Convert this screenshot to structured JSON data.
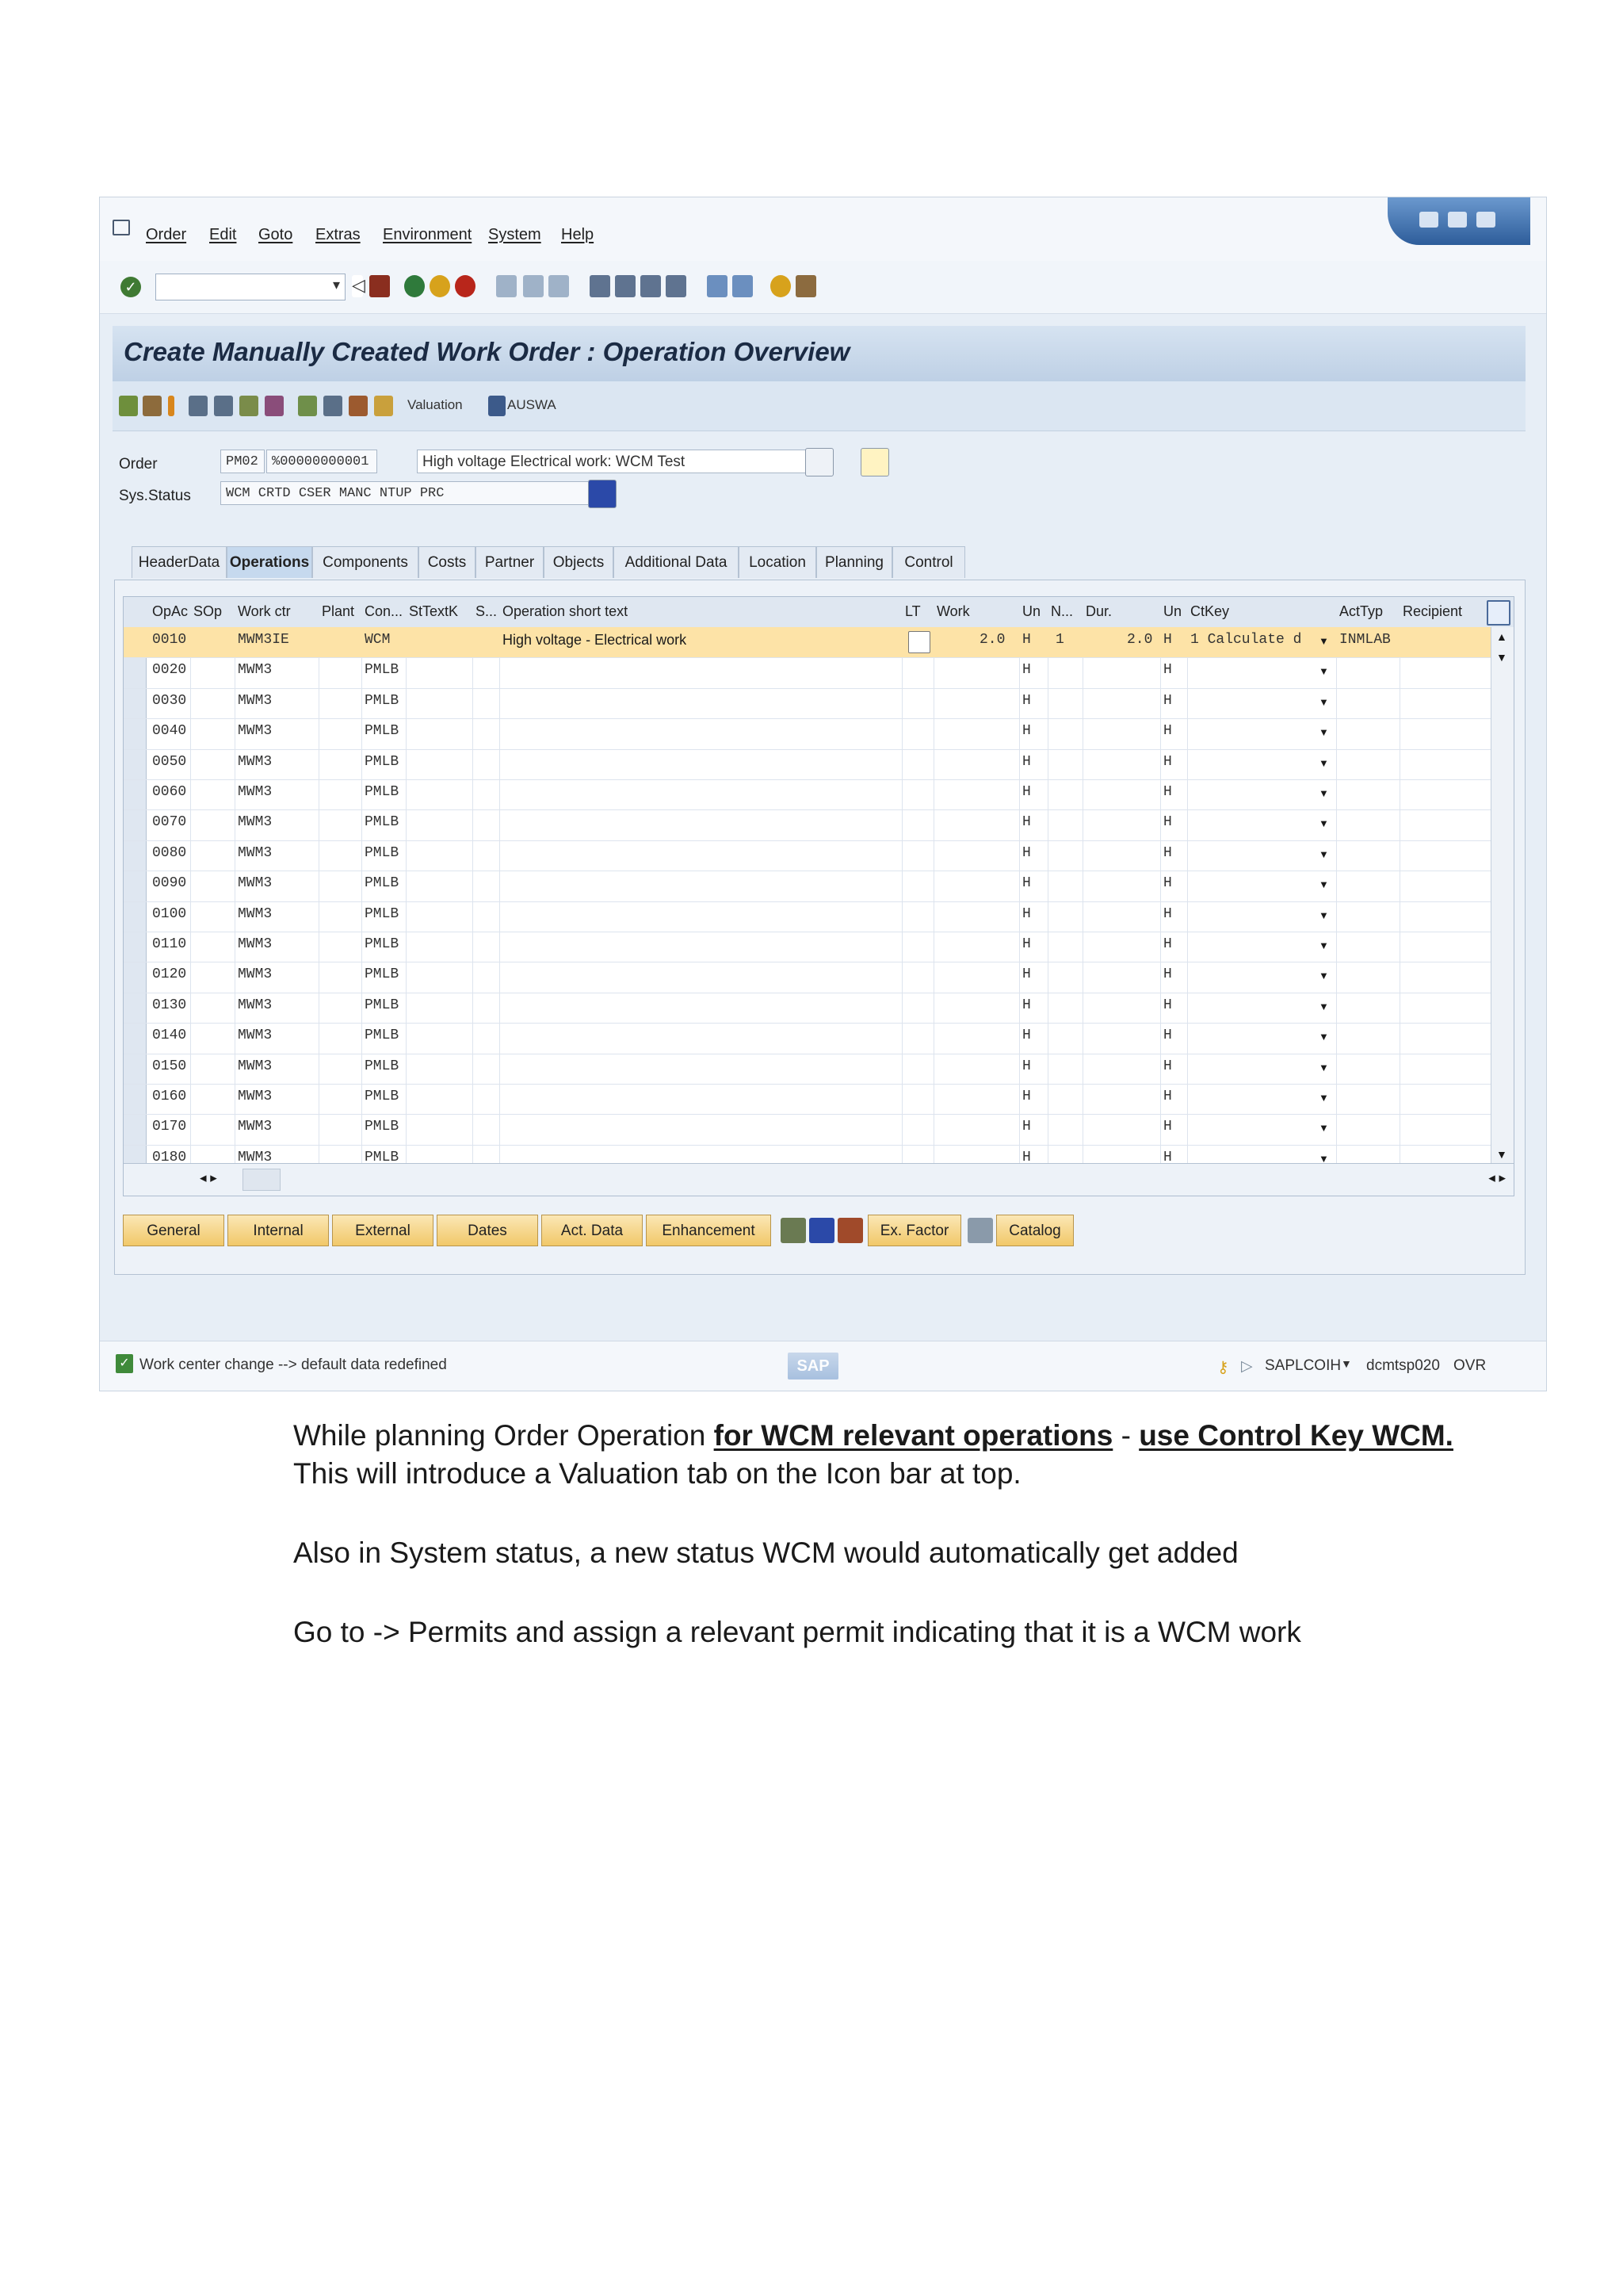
{
  "menu": [
    "Order",
    "Edit",
    "Goto",
    "Extras",
    "Environment",
    "System",
    "Help"
  ],
  "title": "Create Manually Created Work Order : Operation Overview",
  "app_toolbar": {
    "valuation_label": "Valuation",
    "auswa_label": "AUSWA"
  },
  "header": {
    "order_label": "Order",
    "order_type": "PM02",
    "order_number": "%00000000001",
    "order_description": "High voltage Electrical work: WCM Test",
    "sys_status_label": "Sys.Status",
    "sys_status_value": "WCM  CRTD CSER MANC NTUP PRC"
  },
  "tabs": [
    "HeaderData",
    "Operations",
    "Components",
    "Costs",
    "Partner",
    "Objects",
    "Additional Data",
    "Location",
    "Planning",
    "Control"
  ],
  "active_tab": "Operations",
  "grid": {
    "columns": [
      "OpAc",
      "SOp",
      "Work ctr",
      "Plant",
      "Con...",
      "StTextK",
      "S...",
      "Operation short text",
      "LT",
      "Work",
      "Un",
      "N...",
      "Dur.",
      "Un",
      "CtKey",
      "ActTyp",
      "Recipient"
    ],
    "rows": [
      {
        "opac": "0010",
        "workctr": "MWM3IE",
        "con": "WCM",
        "text": "High voltage - Electrical work",
        "work": "2.0",
        "un": "H",
        "n": "1",
        "dur": "2.0",
        "un2": "H",
        "ctkey": "1 Calculate d",
        "acttyp": "INMLAB",
        "selected": true
      },
      {
        "opac": "0020",
        "workctr": "MWM3",
        "con": "PMLB",
        "text": "",
        "work": "",
        "un": "H",
        "n": "",
        "dur": "",
        "un2": "H",
        "ctkey": "",
        "acttyp": ""
      },
      {
        "opac": "0030",
        "workctr": "MWM3",
        "con": "PMLB",
        "text": "",
        "work": "",
        "un": "H",
        "n": "",
        "dur": "",
        "un2": "H",
        "ctkey": "",
        "acttyp": ""
      },
      {
        "opac": "0040",
        "workctr": "MWM3",
        "con": "PMLB",
        "text": "",
        "work": "",
        "un": "H",
        "n": "",
        "dur": "",
        "un2": "H",
        "ctkey": "",
        "acttyp": ""
      },
      {
        "opac": "0050",
        "workctr": "MWM3",
        "con": "PMLB",
        "text": "",
        "work": "",
        "un": "H",
        "n": "",
        "dur": "",
        "un2": "H",
        "ctkey": "",
        "acttyp": ""
      },
      {
        "opac": "0060",
        "workctr": "MWM3",
        "con": "PMLB",
        "text": "",
        "work": "",
        "un": "H",
        "n": "",
        "dur": "",
        "un2": "H",
        "ctkey": "",
        "acttyp": ""
      },
      {
        "opac": "0070",
        "workctr": "MWM3",
        "con": "PMLB",
        "text": "",
        "work": "",
        "un": "H",
        "n": "",
        "dur": "",
        "un2": "H",
        "ctkey": "",
        "acttyp": ""
      },
      {
        "opac": "0080",
        "workctr": "MWM3",
        "con": "PMLB",
        "text": "",
        "work": "",
        "un": "H",
        "n": "",
        "dur": "",
        "un2": "H",
        "ctkey": "",
        "acttyp": ""
      },
      {
        "opac": "0090",
        "workctr": "MWM3",
        "con": "PMLB",
        "text": "",
        "work": "",
        "un": "H",
        "n": "",
        "dur": "",
        "un2": "H",
        "ctkey": "",
        "acttyp": ""
      },
      {
        "opac": "0100",
        "workctr": "MWM3",
        "con": "PMLB",
        "text": "",
        "work": "",
        "un": "H",
        "n": "",
        "dur": "",
        "un2": "H",
        "ctkey": "",
        "acttyp": ""
      },
      {
        "opac": "0110",
        "workctr": "MWM3",
        "con": "PMLB",
        "text": "",
        "work": "",
        "un": "H",
        "n": "",
        "dur": "",
        "un2": "H",
        "ctkey": "",
        "acttyp": ""
      },
      {
        "opac": "0120",
        "workctr": "MWM3",
        "con": "PMLB",
        "text": "",
        "work": "",
        "un": "H",
        "n": "",
        "dur": "",
        "un2": "H",
        "ctkey": "",
        "acttyp": ""
      },
      {
        "opac": "0130",
        "workctr": "MWM3",
        "con": "PMLB",
        "text": "",
        "work": "",
        "un": "H",
        "n": "",
        "dur": "",
        "un2": "H",
        "ctkey": "",
        "acttyp": ""
      },
      {
        "opac": "0140",
        "workctr": "MWM3",
        "con": "PMLB",
        "text": "",
        "work": "",
        "un": "H",
        "n": "",
        "dur": "",
        "un2": "H",
        "ctkey": "",
        "acttyp": ""
      },
      {
        "opac": "0150",
        "workctr": "MWM3",
        "con": "PMLB",
        "text": "",
        "work": "",
        "un": "H",
        "n": "",
        "dur": "",
        "un2": "H",
        "ctkey": "",
        "acttyp": ""
      },
      {
        "opac": "0160",
        "workctr": "MWM3",
        "con": "PMLB",
        "text": "",
        "work": "",
        "un": "H",
        "n": "",
        "dur": "",
        "un2": "H",
        "ctkey": "",
        "acttyp": ""
      },
      {
        "opac": "0170",
        "workctr": "MWM3",
        "con": "PMLB",
        "text": "",
        "work": "",
        "un": "H",
        "n": "",
        "dur": "",
        "un2": "H",
        "ctkey": "",
        "acttyp": ""
      },
      {
        "opac": "0180",
        "workctr": "MWM3",
        "con": "PMLB",
        "text": "",
        "work": "",
        "un": "H",
        "n": "",
        "dur": "",
        "un2": "H",
        "ctkey": "",
        "acttyp": ""
      }
    ]
  },
  "bottom_buttons": {
    "general": "General",
    "internal": "Internal",
    "external": "External",
    "dates": "Dates",
    "act_data": "Act. Data",
    "enhancement": "Enhancement",
    "ex_factor": "Ex. Factor",
    "catalog": "Catalog"
  },
  "statusbar": {
    "message": "Work center change --> default data redefined",
    "logo": "SAP",
    "program": "SAPLCOIH",
    "server": "dcmtsp020",
    "mode": "OVR"
  },
  "text": {
    "line1_plain": "While planning Order Operation ",
    "line1_u1": "for WCM relevant operations",
    "line1_sep": " - ",
    "line1_u2": "use Control Key WCM.",
    "line2": "This will introduce a Valuation tab on the Icon bar at top.",
    "line3": "Also in System status, a new status WCM would automatically get added",
    "line4": "Go to -> Permits and assign a relevant permit indicating that it is a WCM work"
  }
}
